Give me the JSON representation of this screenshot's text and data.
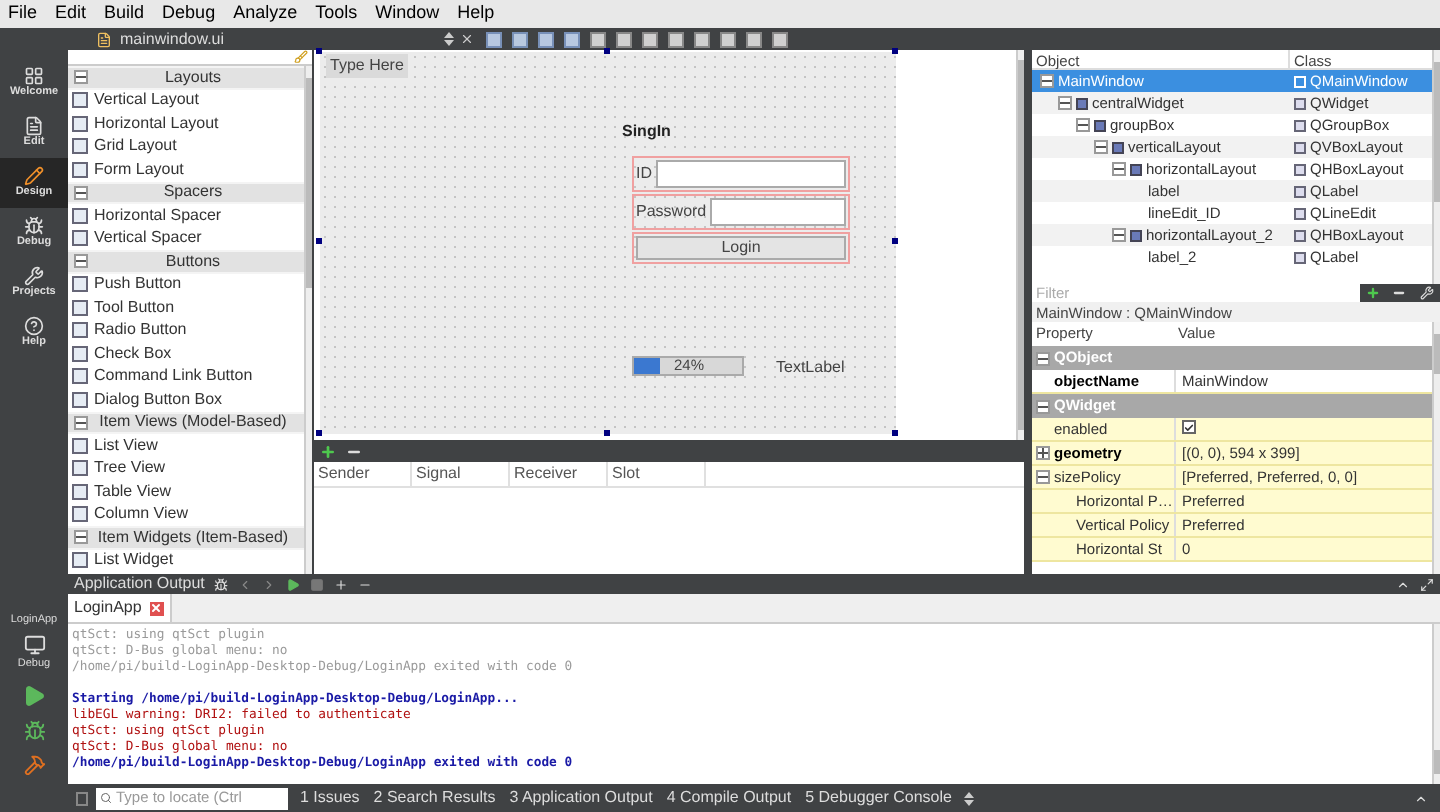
{
  "menu": [
    "File",
    "Edit",
    "Build",
    "Debug",
    "Analyze",
    "Tools",
    "Window",
    "Help"
  ],
  "editor": {
    "file": "mainwindow.ui"
  },
  "modes": [
    {
      "label": "Welcome",
      "selected": false
    },
    {
      "label": "Edit",
      "selected": false
    },
    {
      "label": "Design",
      "selected": true
    },
    {
      "label": "Debug",
      "selected": false
    },
    {
      "label": "Projects",
      "selected": false
    },
    {
      "label": "Help",
      "selected": false
    }
  ],
  "target": {
    "project": "LoginApp",
    "build": "Debug"
  },
  "widget_box": {
    "sections": [
      {
        "title": "Layouts",
        "items": [
          "Vertical Layout",
          "Horizontal Layout",
          "Grid Layout",
          "Form Layout"
        ]
      },
      {
        "title": "Spacers",
        "items": [
          "Horizontal Spacer",
          "Vertical Spacer"
        ]
      },
      {
        "title": "Buttons",
        "items": [
          "Push Button",
          "Tool Button",
          "Radio Button",
          "Check Box",
          "Command Link Button",
          "Dialog Button Box"
        ]
      },
      {
        "title": "Item Views (Model-Based)",
        "items": [
          "List View",
          "Tree View",
          "Table View",
          "Column View"
        ]
      },
      {
        "title": "Item Widgets (Item-Based)",
        "items": [
          "List Widget"
        ]
      }
    ]
  },
  "form": {
    "menu_placeholder": "Type Here",
    "group_title": "SingIn",
    "fields": [
      {
        "label": "ID"
      },
      {
        "label": "Password"
      }
    ],
    "button": "Login",
    "progress": {
      "level": 0.24,
      "text": "24%"
    },
    "text_label": "TextLabel"
  },
  "signal_slot": {
    "columns": [
      "Sender",
      "Signal",
      "Receiver",
      "Slot"
    ]
  },
  "object_inspector": {
    "columns": [
      "Object",
      "Class"
    ],
    "rows": [
      {
        "name": "MainWindow",
        "class": "QMainWindow",
        "selected": true,
        "expanded": true,
        "children": [
          {
            "name": "centralWidget",
            "class": "QWidget",
            "selected": false,
            "expanded": true,
            "children": [
              {
                "name": "groupBox",
                "class": "QGroupBox",
                "selected": false,
                "expanded": true,
                "children": [
                  {
                    "name": "verticalLayout",
                    "class": "QVBoxLayout",
                    "selected": false,
                    "expanded": true,
                    "children": [
                      {
                        "name": "horizontalLayout",
                        "class": "QHBoxLayout",
                        "selected": false,
                        "expanded": true,
                        "children": [
                          {
                            "name": "label",
                            "class": "QLabel",
                            "selected": false
                          },
                          {
                            "name": "lineEdit_ID",
                            "class": "QLineEdit",
                            "selected": false
                          }
                        ]
                      },
                      {
                        "name": "horizontalLayout_2",
                        "class": "QHBoxLayout",
                        "selected": false,
                        "expanded": true,
                        "children": [
                          {
                            "name": "label_2",
                            "class": "QLabel",
                            "selected": false
                          }
                        ]
                      }
                    ]
                  }
                ]
              }
            ]
          }
        ]
      }
    ]
  },
  "property_editor": {
    "filter_placeholder": "Filter",
    "object": "MainWindow : QMainWindow",
    "columns": [
      "Property",
      "Value"
    ],
    "rows": [
      {
        "kind": "group",
        "name": "QObject",
        "expanded": true
      },
      {
        "kind": "text",
        "name": "objectName",
        "value": "MainWindow",
        "modified": true
      },
      {
        "kind": "group",
        "name": "QWidget",
        "expanded": true
      },
      {
        "kind": "check",
        "name": "enabled",
        "checked": true,
        "modified": false
      },
      {
        "kind": "text",
        "name": "geometry",
        "value": "[(0, 0), 594 x 399]",
        "modified": true,
        "expanded": false
      },
      {
        "kind": "text",
        "name": "sizePolicy",
        "value": "[Preferred, Preferred, 0, 0]",
        "modified": false,
        "expanded": true,
        "children": [
          {
            "name": "Horizontal P…",
            "value": "Preferred"
          },
          {
            "name": "Vertical Policy",
            "value": "Preferred"
          },
          {
            "name": "Horizontal St",
            "value": "0"
          }
        ]
      }
    ]
  },
  "output": {
    "title": "Application Output",
    "tabs": [
      {
        "label": "LoginApp"
      }
    ],
    "lines": [
      {
        "kind": "stale",
        "text": "qtSct: using qtSct plugin"
      },
      {
        "kind": "stale",
        "text": "qtSct: D-Bus global menu: no"
      },
      {
        "kind": "stale",
        "text": "/home/pi/build-LoginApp-Desktop-Debug/LoginApp exited with code 0"
      },
      {
        "kind": "start",
        "text": "Starting /home/pi/build-LoginApp-Desktop-Debug/LoginApp..."
      },
      {
        "kind": "stderr",
        "text": "libEGL warning: DRI2: failed to authenticate"
      },
      {
        "kind": "stderr",
        "text": "qtSct: using qtSct plugin"
      },
      {
        "kind": "stderr",
        "text": "qtSct: D-Bus global menu: no"
      },
      {
        "kind": "exit",
        "text": "/home/pi/build-LoginApp-Desktop-Debug/LoginApp exited with code 0"
      }
    ]
  },
  "status": {
    "locator_placeholder": "Type to locate (Ctrl",
    "panes": [
      "1 Issues",
      "2 Search Results",
      "3 Application Output",
      "4 Compile Output",
      "5 Debugger Console"
    ]
  }
}
